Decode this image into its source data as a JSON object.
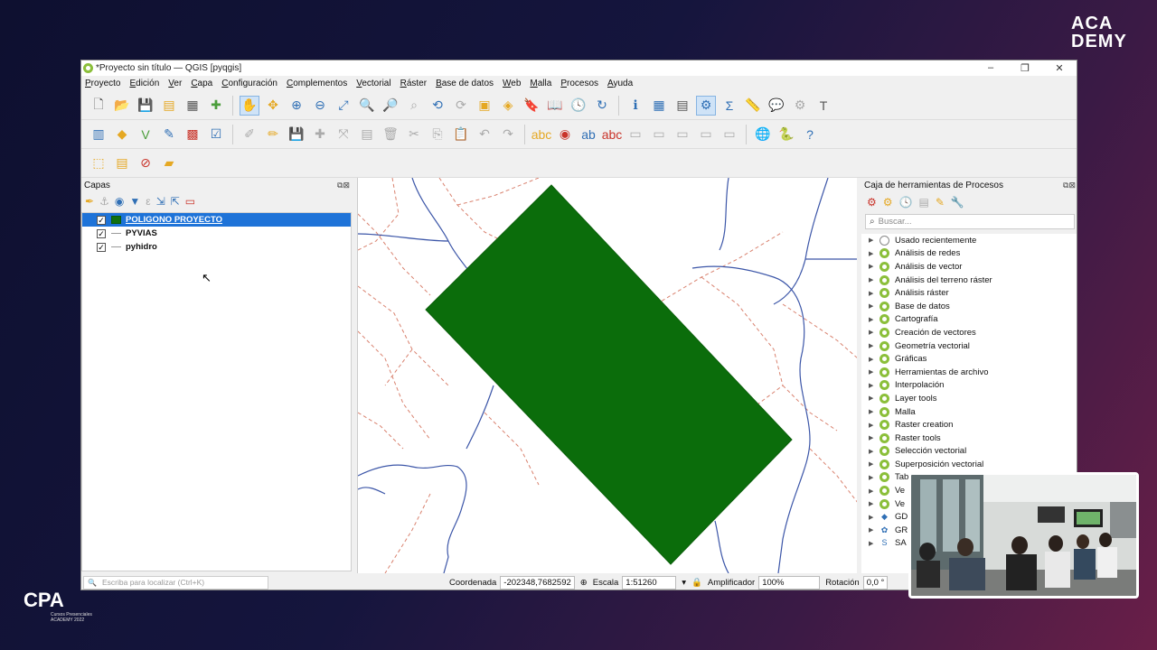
{
  "brand": {
    "top_right_line1": "ACA",
    "top_right_line2": "DEMY",
    "bottom_left_logo": "CPA",
    "bottom_left_tagline": "Cursos Presenciales ACADEMY 2022"
  },
  "window": {
    "title": "*Proyecto sin título — QGIS [pyqgis]",
    "controls": [
      "–",
      "❐",
      "✕"
    ]
  },
  "menu": [
    "Proyecto",
    "Edición",
    "Ver",
    "Capa",
    "Configuración",
    "Complementos",
    "Vectorial",
    "Ráster",
    "Base de datos",
    "Web",
    "Malla",
    "Procesos",
    "Ayuda"
  ],
  "layers_panel": {
    "title": "Capas",
    "layers": [
      {
        "name": "POLIGONO PROYECTO",
        "checked": "✓",
        "symbol": "polygon",
        "color": "#107010",
        "selected": true
      },
      {
        "name": "PYVIAS",
        "checked": "✓",
        "symbol": "line",
        "selected": false
      },
      {
        "name": "pyhidro",
        "checked": "✓",
        "symbol": "line",
        "selected": false
      }
    ]
  },
  "map": {
    "polygon_fill": "#0b6d0b",
    "roads_color": "#d9826f",
    "rivers_color": "#3c56a8"
  },
  "processing": {
    "title": "Caja de herramientas de Procesos",
    "search_placeholder": "Buscar...",
    "items": [
      {
        "label": "Usado recientemente",
        "icon": "clock-icon"
      },
      {
        "label": "Análisis de redes",
        "icon": "qgis-icon"
      },
      {
        "label": "Análisis de vector",
        "icon": "qgis-icon"
      },
      {
        "label": "Análisis del terreno ráster",
        "icon": "qgis-icon"
      },
      {
        "label": "Análisis ráster",
        "icon": "qgis-icon"
      },
      {
        "label": "Base de datos",
        "icon": "qgis-icon"
      },
      {
        "label": "Cartografía",
        "icon": "qgis-icon"
      },
      {
        "label": "Creación de vectores",
        "icon": "qgis-icon"
      },
      {
        "label": "Geometría vectorial",
        "icon": "qgis-icon"
      },
      {
        "label": "Gráficas",
        "icon": "qgis-icon"
      },
      {
        "label": "Herramientas de archivo",
        "icon": "qgis-icon"
      },
      {
        "label": "Interpolación",
        "icon": "qgis-icon"
      },
      {
        "label": "Layer tools",
        "icon": "qgis-icon"
      },
      {
        "label": "Malla",
        "icon": "qgis-icon"
      },
      {
        "label": "Raster creation",
        "icon": "qgis-icon"
      },
      {
        "label": "Raster tools",
        "icon": "qgis-icon"
      },
      {
        "label": "Selección vectorial",
        "icon": "qgis-icon"
      },
      {
        "label": "Superposición vectorial",
        "icon": "qgis-icon"
      },
      {
        "label": "Tab",
        "icon": "qgis-icon"
      },
      {
        "label": "Ve",
        "icon": "qgis-icon"
      },
      {
        "label": "Ve",
        "icon": "qgis-icon"
      },
      {
        "label": "GD",
        "icon": "gdal-icon"
      },
      {
        "label": "GR",
        "icon": "grass-icon"
      },
      {
        "label": "SA",
        "icon": "saga-icon"
      }
    ]
  },
  "status": {
    "locate_placeholder": "Escriba para localizar (Ctrl+K)",
    "coord_label": "Coordenada",
    "coord_value": "-202348,7682592",
    "scale_label": "Escala",
    "scale_value": "1:51260",
    "magnifier_label": "Amplificador",
    "magnifier_value": "100%",
    "rotation_label": "Rotación",
    "rotation_value": "0,0 °"
  }
}
